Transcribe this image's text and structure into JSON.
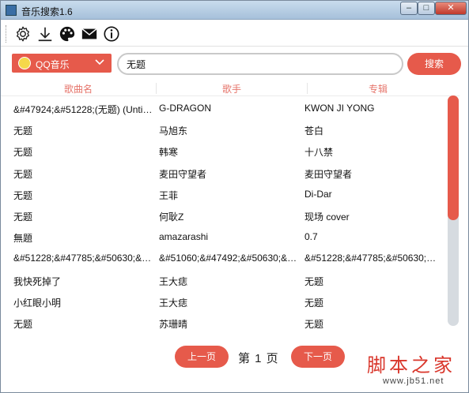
{
  "window": {
    "title": "音乐搜索1.6",
    "min": "–",
    "max": "□",
    "close": "✕"
  },
  "toolbar": {
    "icons": [
      "gear-icon",
      "download-icon",
      "palette-icon",
      "mail-icon",
      "info-icon"
    ]
  },
  "search": {
    "source_label": "QQ音乐",
    "query": "无题",
    "button_label": "搜索"
  },
  "table": {
    "headers": [
      "歌曲名",
      "歌手",
      "专辑"
    ],
    "rows": [
      [
        "&#47924;&#51228;(无题) (Untitl...",
        "G-DRAGON",
        "KWON JI YONG"
      ],
      [
        "无题",
        "马旭东",
        "苍白"
      ],
      [
        "无题",
        "韩寒",
        "十八禁"
      ],
      [
        "无题",
        "麦田守望者",
        "麦田守望者"
      ],
      [
        "无题",
        "王菲",
        "Di-Dar"
      ],
      [
        "无题",
        "何耿Z",
        "现场 cover"
      ],
      [
        "無題",
        "amazarashi",
        "0.7"
      ],
      [
        "&#51228;&#47785;&#50630;&#...",
        "&#51060;&#47492;&#50630;&#...",
        "&#51228;&#47785;&#50630;&..."
      ],
      [
        "我快死掉了",
        "王大痣",
        "无题"
      ],
      [
        "小红眼小明",
        "王大痣",
        "无题"
      ],
      [
        "无题",
        "苏珊晴",
        "无题"
      ]
    ]
  },
  "scrollbar": {
    "position_fraction": 0.0,
    "visible_fraction": 0.54
  },
  "pager": {
    "prev_label": "上一页",
    "page_text": "第 1 页",
    "next_label": "下一页"
  },
  "watermark": {
    "brand": "脚本之家",
    "url": "www.jb51.net"
  },
  "colors": {
    "accent": "#e65a4b",
    "header_text": "#e6756b"
  }
}
